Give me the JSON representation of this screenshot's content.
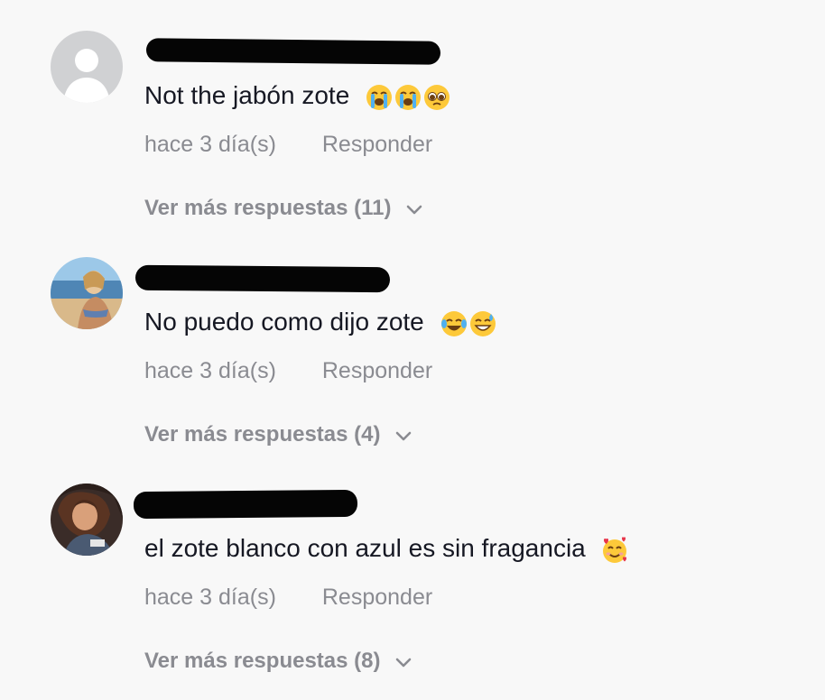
{
  "comments": [
    {
      "text": "Not the jabón zote",
      "emojis": [
        "loudly-crying-face-emoji",
        "loudly-crying-face-emoji",
        "pleading-face-emoji"
      ],
      "timestamp": "hace 3 día(s)",
      "reply_label": "Responder",
      "more_replies_label": "Ver más respuestas (11)"
    },
    {
      "text": "No puedo como dijo zote",
      "emojis": [
        "face-with-tears-of-joy-emoji",
        "grinning-face-with-sweat-emoji"
      ],
      "timestamp": "hace 3 día(s)",
      "reply_label": "Responder",
      "more_replies_label": "Ver más respuestas (4)"
    },
    {
      "text": "el zote blanco con azul es sin fragancia",
      "emojis": [
        "smiling-face-with-hearts-emoji"
      ],
      "timestamp": "hace 3 día(s)",
      "reply_label": "Responder",
      "more_replies_label": "Ver más respuestas (8)"
    }
  ],
  "colors": {
    "background": "#f8f8f8",
    "text_primary": "#161823",
    "text_secondary": "#8a8b91",
    "redaction": "#050505"
  }
}
